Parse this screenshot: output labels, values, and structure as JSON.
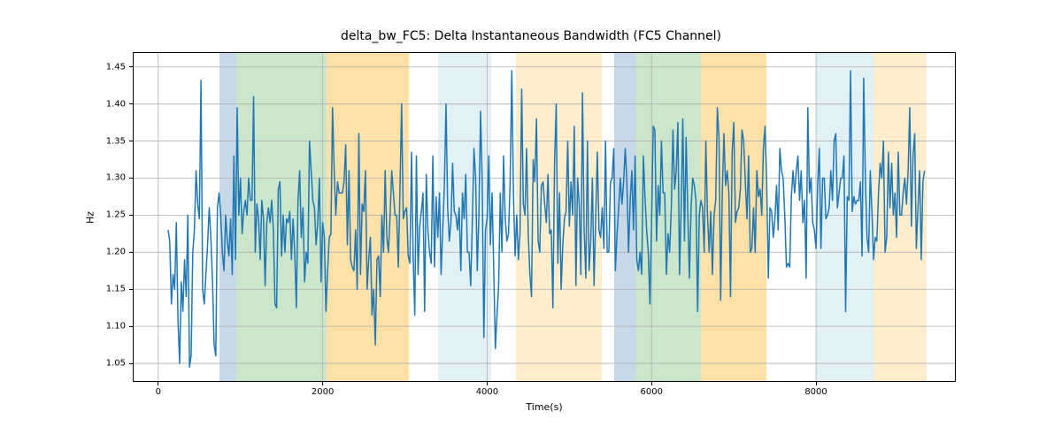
{
  "chart_data": {
    "type": "line",
    "title": "delta_bw_FC5: Delta Instantaneous Bandwidth (FC5 Channel)",
    "xlabel": "Time(s)",
    "ylabel": "Hz",
    "xlim": [
      -310,
      9700
    ],
    "ylim": [
      1.025,
      1.47
    ],
    "x_ticks": [
      0,
      2000,
      4000,
      6000,
      8000
    ],
    "y_ticks": [
      1.05,
      1.1,
      1.15,
      1.2,
      1.25,
      1.3,
      1.35,
      1.4,
      1.45
    ],
    "x_tick_labels": [
      "0",
      "2000",
      "4000",
      "6000",
      "8000"
    ],
    "y_tick_labels": [
      "1.05",
      "1.10",
      "1.15",
      "1.20",
      "1.25",
      "1.30",
      "1.35",
      "1.40",
      "1.45"
    ],
    "regions": [
      {
        "start": 750,
        "end": 950,
        "color": "steelblue"
      },
      {
        "start": 950,
        "end": 2050,
        "color": "green"
      },
      {
        "start": 2050,
        "end": 3050,
        "color": "orange-s"
      },
      {
        "start": 3400,
        "end": 4050,
        "color": "lightblue"
      },
      {
        "start": 4350,
        "end": 5400,
        "color": "orange-l"
      },
      {
        "start": 5550,
        "end": 5800,
        "color": "steelblue"
      },
      {
        "start": 5800,
        "end": 6600,
        "color": "green"
      },
      {
        "start": 6600,
        "end": 7400,
        "color": "orange-s"
      },
      {
        "start": 8000,
        "end": 8700,
        "color": "lightblue"
      },
      {
        "start": 8700,
        "end": 9350,
        "color": "orange-l"
      }
    ],
    "series": [
      {
        "name": "delta_bw_FC5",
        "x_step": 20,
        "x_start": 120,
        "values": [
          1.23,
          1.215,
          1.13,
          1.17,
          1.15,
          1.24,
          1.11,
          1.05,
          1.16,
          1.12,
          1.19,
          1.14,
          1.25,
          1.045,
          1.06,
          1.2,
          1.23,
          1.31,
          1.265,
          1.245,
          1.432,
          1.15,
          1.13,
          1.17,
          1.21,
          1.26,
          1.22,
          1.16,
          1.075,
          1.06,
          1.26,
          1.28,
          1.25,
          1.2,
          1.175,
          1.25,
          1.215,
          1.195,
          1.245,
          1.17,
          1.33,
          1.19,
          1.395,
          1.25,
          1.3,
          1.225,
          1.255,
          1.27,
          1.25,
          1.3,
          1.27,
          1.27,
          1.41,
          1.2,
          1.265,
          1.245,
          1.19,
          1.27,
          1.245,
          1.155,
          1.24,
          1.26,
          1.24,
          1.27,
          1.23,
          1.13,
          1.125,
          1.285,
          1.295,
          1.195,
          1.25,
          1.2,
          1.245,
          1.24,
          1.255,
          1.19,
          1.245,
          1.2,
          1.125,
          1.27,
          1.31,
          1.22,
          1.26,
          1.16,
          1.2,
          1.185,
          1.35,
          1.31,
          1.27,
          1.26,
          1.21,
          1.24,
          1.3,
          1.16,
          1.24,
          1.22,
          1.12,
          1.175,
          1.22,
          1.225,
          1.395,
          1.31,
          1.25,
          1.295,
          1.28,
          1.28,
          1.28,
          1.295,
          1.345,
          1.21,
          1.31,
          1.19,
          1.18,
          1.175,
          1.23,
          1.15,
          1.36,
          1.17,
          1.265,
          1.255,
          1.31,
          1.15,
          1.19,
          1.22,
          1.115,
          1.15,
          1.075,
          1.19,
          1.195,
          1.14,
          1.25,
          1.2,
          1.31,
          1.22,
          1.2,
          1.25,
          1.31,
          1.28,
          1.25,
          1.25,
          1.18,
          1.285,
          1.4,
          1.245,
          1.255,
          1.26,
          1.195,
          1.185,
          1.335,
          1.195,
          1.115,
          1.33,
          1.17,
          1.235,
          1.255,
          1.28,
          1.12,
          1.305,
          1.23,
          1.2,
          1.185,
          1.33,
          1.18,
          1.275,
          1.22,
          1.28,
          1.17,
          1.23,
          1.29,
          1.4,
          1.26,
          1.215,
          1.24,
          1.32,
          1.255,
          1.25,
          1.23,
          1.26,
          1.175,
          1.28,
          1.245,
          1.305,
          1.2,
          1.2,
          1.155,
          1.24,
          1.34,
          1.3,
          1.175,
          1.25,
          1.39,
          1.295,
          1.085,
          1.23,
          1.245,
          1.33,
          1.21,
          1.28,
          1.18,
          1.07,
          1.115,
          1.155,
          1.28,
          1.2,
          1.33,
          1.245,
          1.215,
          1.225,
          1.295,
          1.445,
          1.28,
          1.195,
          1.25,
          1.19,
          1.225,
          1.42,
          1.265,
          1.25,
          1.34,
          1.225,
          1.17,
          1.14,
          1.325,
          1.295,
          1.38,
          1.215,
          1.2,
          1.29,
          1.295,
          1.265,
          1.24,
          1.305,
          1.225,
          1.23,
          1.125,
          1.32,
          1.4,
          1.185,
          1.28,
          1.15,
          1.21,
          1.245,
          1.255,
          1.35,
          1.235,
          1.295,
          1.25,
          1.37,
          1.155,
          1.3,
          1.265,
          1.17,
          1.415,
          1.23,
          1.165,
          1.35,
          1.175,
          1.215,
          1.3,
          1.155,
          1.245,
          1.335,
          1.23,
          1.22,
          1.26,
          1.205,
          1.35,
          1.2,
          1.2,
          1.295,
          1.3,
          1.34,
          1.175,
          1.225,
          1.26,
          1.3,
          1.265,
          1.295,
          1.34,
          1.295,
          1.2,
          1.27,
          1.31,
          1.23,
          1.33,
          1.19,
          1.175,
          1.2,
          1.17,
          1.33,
          1.275,
          1.23,
          1.2,
          1.13,
          1.24,
          1.37,
          1.365,
          1.215,
          1.29,
          1.25,
          1.35,
          1.28,
          1.28,
          1.17,
          1.225,
          1.2,
          1.26,
          1.365,
          1.285,
          1.31,
          1.375,
          1.17,
          1.26,
          1.38,
          1.215,
          1.355,
          1.255,
          1.165,
          1.26,
          1.3,
          1.29,
          1.27,
          1.12,
          1.25,
          1.27,
          1.26,
          1.2,
          1.35,
          1.25,
          1.2,
          1.255,
          1.17,
          1.25,
          1.27,
          1.395,
          1.355,
          1.135,
          1.28,
          1.36,
          1.29,
          1.31,
          1.28,
          1.14,
          1.335,
          1.375,
          1.24,
          1.255,
          1.26,
          1.285,
          1.365,
          1.35,
          1.295,
          1.245,
          1.33,
          1.2,
          1.205,
          1.26,
          1.2,
          1.31,
          1.275,
          1.285,
          1.25,
          1.34,
          1.37,
          1.295,
          1.165,
          1.26,
          1.255,
          1.22,
          1.245,
          1.29,
          1.23,
          1.34,
          1.31,
          1.3,
          1.25,
          1.18,
          1.185,
          1.18,
          1.275,
          1.31,
          1.28,
          1.31,
          1.33,
          1.27,
          1.31,
          1.24,
          1.27,
          1.165,
          1.395,
          1.28,
          1.3,
          1.24,
          1.23,
          1.205,
          1.29,
          1.34,
          1.205,
          1.3,
          1.3,
          1.245,
          1.25,
          1.26,
          1.31,
          1.27,
          1.35,
          1.36,
          1.26,
          1.28,
          1.3,
          1.3,
          1.33,
          1.12,
          1.275,
          1.27,
          1.445,
          1.255,
          1.275,
          1.265,
          1.27,
          1.27,
          1.295,
          1.195,
          1.435,
          1.3,
          1.22,
          1.2,
          1.31,
          1.255,
          1.19,
          1.22,
          1.215,
          1.28,
          1.32,
          1.3,
          1.35,
          1.2,
          1.22,
          1.335,
          1.26,
          1.32,
          1.25,
          1.28,
          1.22,
          1.335,
          1.25,
          1.25,
          1.28,
          1.3,
          1.265,
          1.31,
          1.395,
          1.235,
          1.33,
          1.36,
          1.205,
          1.26,
          1.31,
          1.19,
          1.295,
          1.31
        ]
      }
    ]
  },
  "layout": {
    "fig_w": 1200,
    "fig_h": 500,
    "ax_left": 150,
    "ax_top": 59,
    "ax_w": 930,
    "ax_h": 373,
    "title_top": 33
  }
}
